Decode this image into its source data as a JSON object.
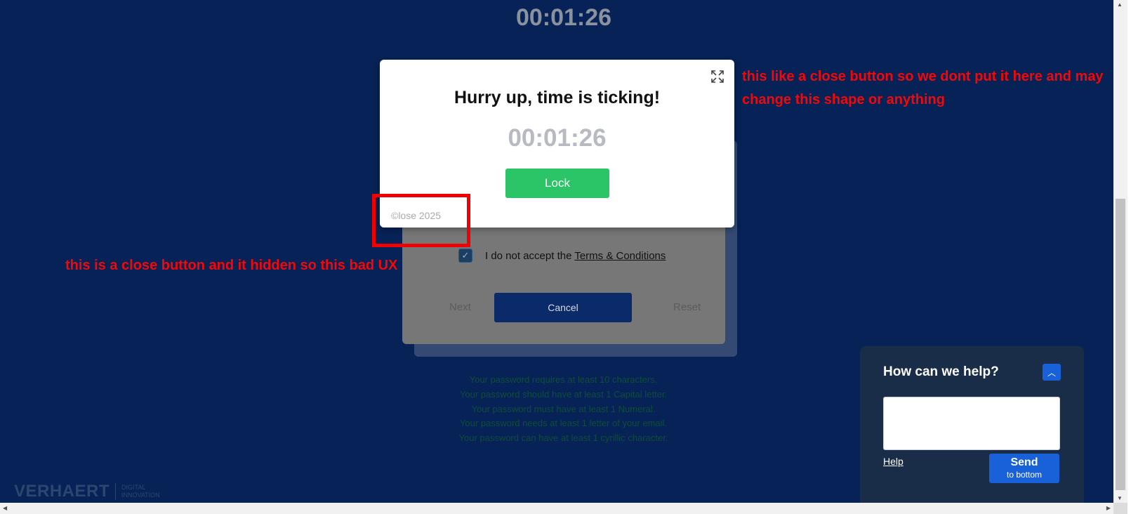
{
  "page": {
    "top_timer": "00:01:26"
  },
  "form_card": {
    "checkbox_prefix": "I do not accept the ",
    "terms_link": "Terms & Conditions",
    "next_label": "Next",
    "cancel_label": "Cancel",
    "reset_label": "Reset"
  },
  "password_rules": [
    "Your password requires at least 10 characters.",
    "Your password should have at least 1 Capital letter.",
    "Your password must have at least 1 Numeral.",
    "Your password needs at least 1 letter of your email.",
    "Your password can have at least 1 cyrillic character."
  ],
  "modal": {
    "title": "Hurry up, time is ticking!",
    "timer": "00:01:26",
    "lock_label": "Lock",
    "copyright": "©lose 2025"
  },
  "annotations": {
    "right": "this like a close button so we dont put it here and may change this shape or anything",
    "left": "this is a close button and it hidden so this bad UX"
  },
  "logo": {
    "main": "VERHAERT",
    "sub_line1": "DIGITAL",
    "sub_line2": "INNOVATION"
  },
  "help_widget": {
    "title": "How can we help?",
    "help_link": "Help",
    "send_label": "Send",
    "send_sub": "to bottom"
  },
  "colors": {
    "background": "#072256",
    "lock_button": "#2bc466",
    "annotation": "#f20808",
    "send_button": "#1861d8"
  }
}
